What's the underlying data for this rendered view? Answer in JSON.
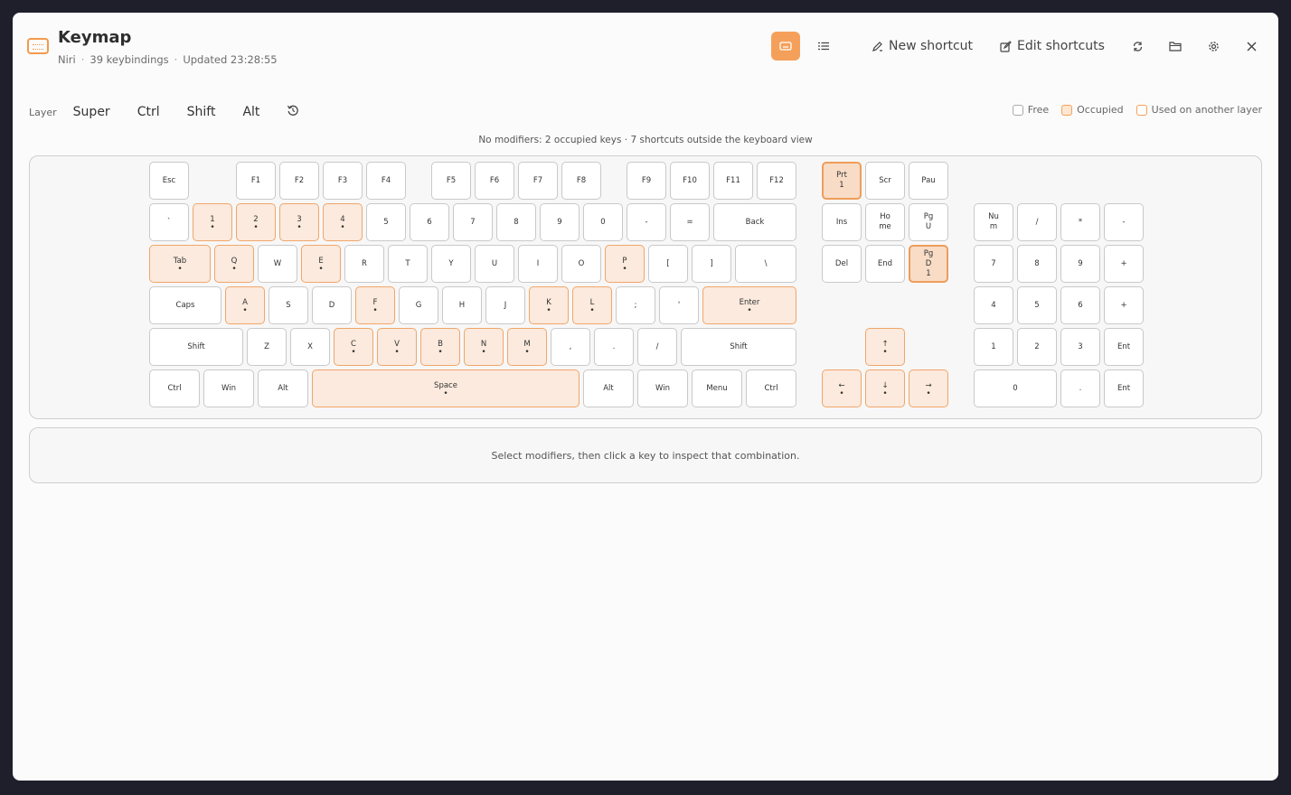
{
  "header": {
    "title": "Keymap",
    "compositor": "Niri",
    "bindings": "39 keybindings",
    "updated": "Updated 23:28:55",
    "new_shortcut": "New shortcut",
    "edit_shortcuts": "Edit shortcuts"
  },
  "layer": {
    "label": "Layer",
    "modifiers": [
      "Super",
      "Ctrl",
      "Shift",
      "Alt"
    ]
  },
  "legend": {
    "free": "Free",
    "occupied": "Occupied",
    "other_layer": "Used on another layer"
  },
  "status": "No modifiers: 2 occupied keys · 7 shortcuts outside the keyboard view",
  "inspect_hint": "Select modifiers, then click a key to inspect that combination.",
  "colors": {
    "accent": "#f5a05a",
    "occupied_bg": "#fbeadd",
    "occupied_border": "#f1a66a"
  },
  "keys": [
    {
      "label": "Esc",
      "state": "free"
    },
    {
      "label": "F1",
      "state": "free"
    },
    {
      "label": "F2",
      "state": "free"
    },
    {
      "label": "F3",
      "state": "free"
    },
    {
      "label": "F4",
      "state": "free"
    },
    {
      "label": "F5",
      "state": "free"
    },
    {
      "label": "F6",
      "state": "free"
    },
    {
      "label": "F7",
      "state": "free"
    },
    {
      "label": "F8",
      "state": "free"
    },
    {
      "label": "F9",
      "state": "free"
    },
    {
      "label": "F10",
      "state": "free"
    },
    {
      "label": "F11",
      "state": "free"
    },
    {
      "label": "F12",
      "state": "free"
    },
    {
      "label": "Prt\n1",
      "state": "strong"
    },
    {
      "label": "Scr",
      "state": "free"
    },
    {
      "label": "Pau",
      "state": "free"
    },
    {
      "label": "`",
      "state": "free"
    },
    {
      "label": "1",
      "state": "occ"
    },
    {
      "label": "2",
      "state": "occ"
    },
    {
      "label": "3",
      "state": "occ"
    },
    {
      "label": "4",
      "state": "occ"
    },
    {
      "label": "5",
      "state": "free"
    },
    {
      "label": "6",
      "state": "free"
    },
    {
      "label": "7",
      "state": "free"
    },
    {
      "label": "8",
      "state": "free"
    },
    {
      "label": "9",
      "state": "free"
    },
    {
      "label": "0",
      "state": "free"
    },
    {
      "label": "-",
      "state": "free"
    },
    {
      "label": "=",
      "state": "free"
    },
    {
      "label": "Back",
      "state": "free"
    },
    {
      "label": "Ins",
      "state": "free"
    },
    {
      "label": "Ho\nme",
      "state": "free"
    },
    {
      "label": "Pg\nU",
      "state": "free"
    },
    {
      "label": "Nu\nm",
      "state": "free"
    },
    {
      "label": "/",
      "state": "free"
    },
    {
      "label": "*",
      "state": "free"
    },
    {
      "label": "-",
      "state": "free"
    },
    {
      "label": "Tab",
      "state": "occ"
    },
    {
      "label": "Q",
      "state": "occ"
    },
    {
      "label": "W",
      "state": "free"
    },
    {
      "label": "E",
      "state": "occ"
    },
    {
      "label": "R",
      "state": "free"
    },
    {
      "label": "T",
      "state": "free"
    },
    {
      "label": "Y",
      "state": "free"
    },
    {
      "label": "U",
      "state": "free"
    },
    {
      "label": "I",
      "state": "free"
    },
    {
      "label": "O",
      "state": "free"
    },
    {
      "label": "P",
      "state": "occ"
    },
    {
      "label": "[",
      "state": "free"
    },
    {
      "label": "]",
      "state": "free"
    },
    {
      "label": "\\",
      "state": "free"
    },
    {
      "label": "Del",
      "state": "free"
    },
    {
      "label": "End",
      "state": "free"
    },
    {
      "label": "Pg\nD\n1",
      "state": "strong"
    },
    {
      "label": "7",
      "state": "free"
    },
    {
      "label": "8",
      "state": "free"
    },
    {
      "label": "9",
      "state": "free"
    },
    {
      "label": "+",
      "state": "free"
    },
    {
      "label": "Caps",
      "state": "free"
    },
    {
      "label": "A",
      "state": "occ"
    },
    {
      "label": "S",
      "state": "free"
    },
    {
      "label": "D",
      "state": "free"
    },
    {
      "label": "F",
      "state": "occ"
    },
    {
      "label": "G",
      "state": "free"
    },
    {
      "label": "H",
      "state": "free"
    },
    {
      "label": "J",
      "state": "free"
    },
    {
      "label": "K",
      "state": "occ"
    },
    {
      "label": "L",
      "state": "occ"
    },
    {
      "label": ";",
      "state": "free"
    },
    {
      "label": "'",
      "state": "free"
    },
    {
      "label": "Enter",
      "state": "occ"
    },
    {
      "label": "4",
      "state": "free"
    },
    {
      "label": "5",
      "state": "free"
    },
    {
      "label": "6",
      "state": "free"
    },
    {
      "label": "+",
      "state": "free"
    },
    {
      "label": "Shift",
      "state": "free"
    },
    {
      "label": "Z",
      "state": "free"
    },
    {
      "label": "X",
      "state": "free"
    },
    {
      "label": "C",
      "state": "occ"
    },
    {
      "label": "V",
      "state": "occ"
    },
    {
      "label": "B",
      "state": "occ"
    },
    {
      "label": "N",
      "state": "occ"
    },
    {
      "label": "M",
      "state": "occ"
    },
    {
      "label": ",",
      "state": "free"
    },
    {
      "label": ".",
      "state": "free"
    },
    {
      "label": "/",
      "state": "free"
    },
    {
      "label": "Shift",
      "state": "free"
    },
    {
      "label": "↑",
      "state": "occ"
    },
    {
      "label": "1",
      "state": "free"
    },
    {
      "label": "2",
      "state": "free"
    },
    {
      "label": "3",
      "state": "free"
    },
    {
      "label": "Ent",
      "state": "free"
    },
    {
      "label": "Ctrl",
      "state": "free"
    },
    {
      "label": "Win",
      "state": "free"
    },
    {
      "label": "Alt",
      "state": "free"
    },
    {
      "label": "Space",
      "state": "occ"
    },
    {
      "label": "Alt",
      "state": "free"
    },
    {
      "label": "Win",
      "state": "free"
    },
    {
      "label": "Menu",
      "state": "free"
    },
    {
      "label": "Ctrl",
      "state": "free"
    },
    {
      "label": "←",
      "state": "occ"
    },
    {
      "label": "↓",
      "state": "occ"
    },
    {
      "label": "→",
      "state": "occ"
    },
    {
      "label": "0",
      "state": "free"
    },
    {
      "label": ".",
      "state": "free"
    },
    {
      "label": "Ent",
      "state": "free"
    }
  ]
}
